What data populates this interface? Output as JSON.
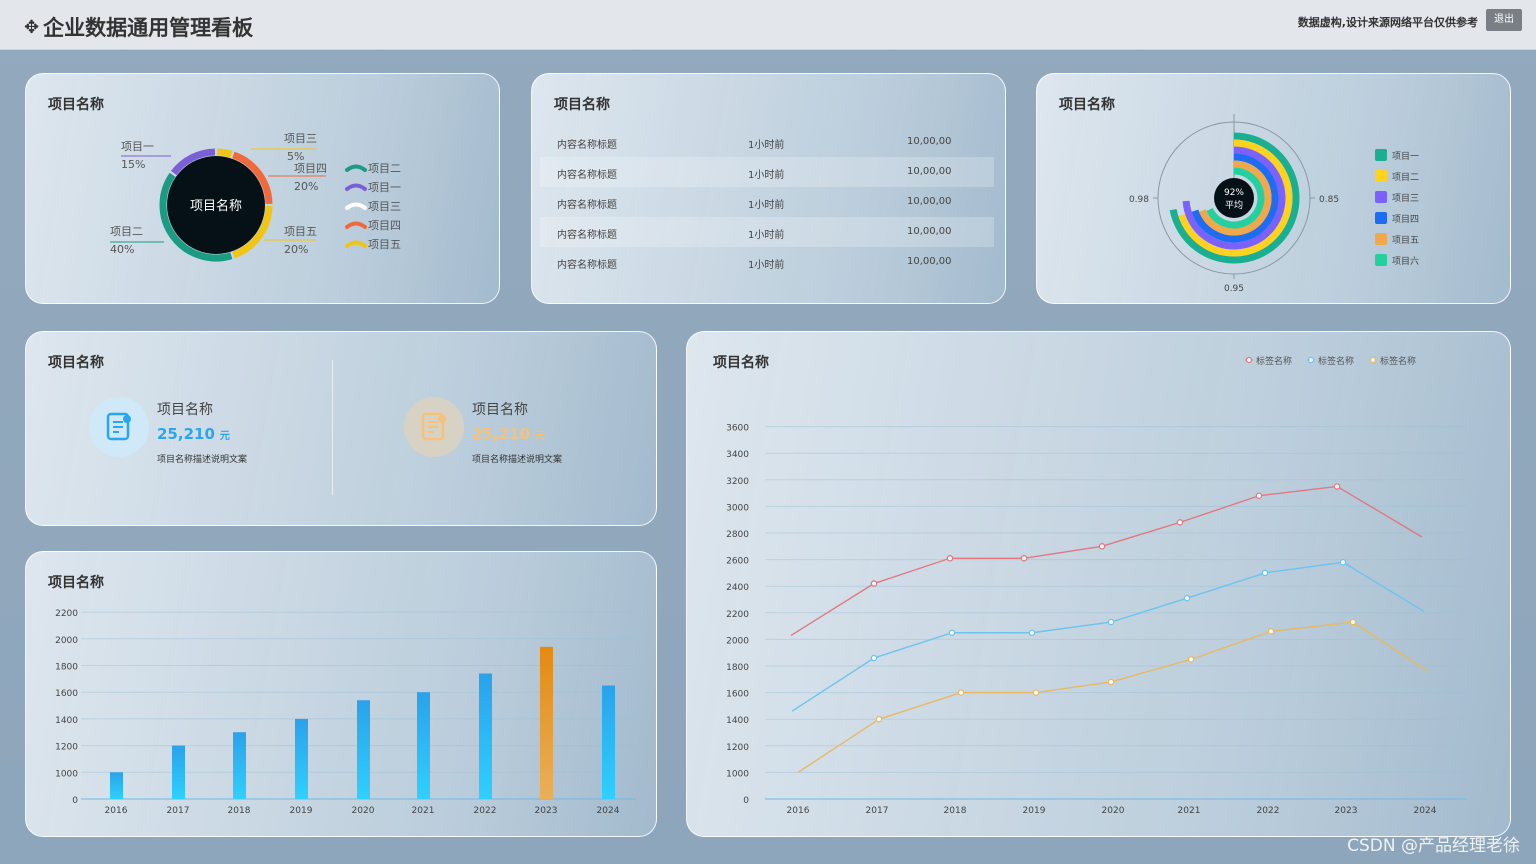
{
  "header": {
    "title": "企业数据通用管理看板",
    "note": "数据虚构,设计来源网络平台仅供参考",
    "logout": "退出"
  },
  "panels": {
    "p1": "项目名称",
    "p2": "项目名称",
    "p3": "项目名称",
    "p4": "项目名称",
    "p5": "项目名称",
    "p6": "项目名称"
  },
  "list": {
    "rows": [
      {
        "title": "内容名称标题",
        "time": "1小时前",
        "value": "10,00,00"
      },
      {
        "title": "内容名称标题",
        "time": "1小时前",
        "value": "10,00,00"
      },
      {
        "title": "内容名称标题",
        "time": "1小时前",
        "value": "10,00,00"
      },
      {
        "title": "内容名称标题",
        "time": "1小时前",
        "value": "10,00,00"
      },
      {
        "title": "内容名称标题",
        "time": "1小时前",
        "value": "10,00,00"
      }
    ]
  },
  "stats": [
    {
      "name": "项目名称",
      "value": "25,210",
      "unit": "元",
      "desc": "项目名称描述说明文案",
      "color": "#2aa7ec",
      "bg": "#cfe9f8"
    },
    {
      "name": "项目名称",
      "value": "25,210",
      "unit": "元",
      "desc": "项目名称描述说明文案",
      "color": "#f4c27a",
      "bg": "#d8d2c4"
    }
  ],
  "watermark": "CSDN @产品经理老徐",
  "chart_data": [
    {
      "type": "pie",
      "center": "项目名称",
      "slices": [
        {
          "name": "项目一",
          "value": 15,
          "label": "15%",
          "color": "#7b5fd6"
        },
        {
          "name": "项目三",
          "value": 5,
          "label": "5%",
          "color": "#f0c514"
        },
        {
          "name": "项目四",
          "value": 20,
          "label": "20%",
          "color": "#f0693a"
        },
        {
          "name": "项目五",
          "value": 20,
          "label": "20%",
          "color": "#f0c514"
        },
        {
          "name": "项目二",
          "value": 40,
          "label": "40%",
          "color": "#1b9b83"
        }
      ],
      "legend": [
        {
          "name": "项目二",
          "color": "#1b9b83"
        },
        {
          "name": "项目一",
          "color": "#7b5fd6"
        },
        {
          "name": "项目三",
          "color": "#ffffff"
        },
        {
          "name": "项目四",
          "color": "#f0693a"
        },
        {
          "name": "项目五",
          "color": "#f0c514"
        }
      ]
    },
    {
      "type": "bar",
      "subtype": "polar-radial",
      "center_value": "92%",
      "center_label": "平均",
      "tick_labels": {
        "left": "0.98",
        "right": "0.85",
        "bottom": "0.95"
      },
      "series": [
        {
          "name": "项目一",
          "value": 0.72,
          "color": "#1aaf90"
        },
        {
          "name": "项目二",
          "value": 0.7,
          "color": "#ffd21f"
        },
        {
          "name": "项目三",
          "value": 0.74,
          "color": "#7b61ff"
        },
        {
          "name": "项目四",
          "value": 0.7,
          "color": "#1e6cf2"
        },
        {
          "name": "项目五",
          "value": 0.69,
          "color": "#f0a84a"
        },
        {
          "name": "项目六",
          "value": 0.68,
          "color": "#25d0a0"
        }
      ]
    },
    {
      "type": "bar",
      "categories": [
        "2016",
        "2017",
        "2018",
        "2019",
        "2020",
        "2021",
        "2022",
        "2023",
        "2024"
      ],
      "values": [
        1000,
        1200,
        1300,
        1400,
        1540,
        1600,
        1740,
        1940,
        1650
      ],
      "yticks": [
        0,
        1000,
        1200,
        1400,
        1600,
        1800,
        2000,
        2200
      ],
      "highlight": "2023",
      "color": "#2bb4ef",
      "highlight_color": "#f09a1c"
    },
    {
      "type": "line",
      "x": [
        "2016",
        "2017",
        "2018",
        "2019",
        "2020",
        "2021",
        "2022",
        "2023",
        "2024"
      ],
      "yticks": [
        0,
        1000,
        1200,
        1400,
        1600,
        1800,
        2000,
        2200,
        2400,
        2600,
        2800,
        3000,
        3200,
        3400,
        3600
      ],
      "series": [
        {
          "name": "标签名称",
          "color": "#e07880",
          "values": [
            2030,
            2420,
            2610,
            2610,
            2700,
            2880,
            3080,
            3150,
            2770
          ]
        },
        {
          "name": "标签名称",
          "color": "#6cc4ee",
          "values": [
            1460,
            1860,
            2050,
            2050,
            2130,
            2310,
            2500,
            2580,
            2210
          ]
        },
        {
          "name": "标签名称",
          "color": "#e8b862",
          "values": [
            1000,
            1400,
            1600,
            1600,
            1680,
            1850,
            2060,
            2130,
            1760
          ]
        }
      ]
    }
  ]
}
